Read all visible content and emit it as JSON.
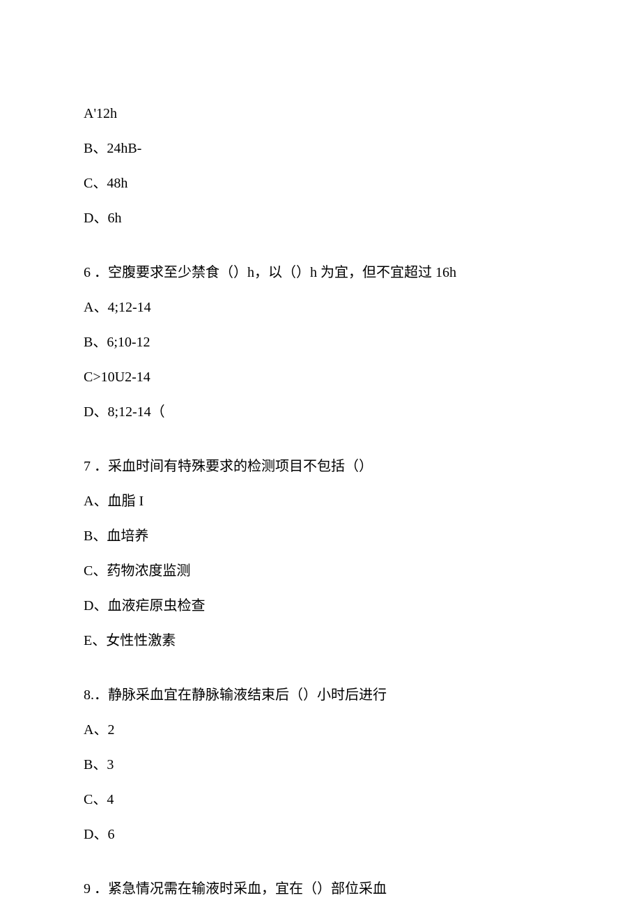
{
  "q5": {
    "optA": "A'12h",
    "optB": "B、24hB-",
    "optC": "C、48h",
    "optD": "D、6h"
  },
  "q6": {
    "stem": "6 ．空腹要求至少禁食（）h，以（）h 为宜，但不宜超过 16h",
    "optA": "A、4;12-14",
    "optB": "B、6;10-12",
    "optC": "C>10U2-14",
    "optD": "D、8;12-14（"
  },
  "q7": {
    "stem": "7 ．采血时间有特殊要求的检测项目不包括（）",
    "optA": "A、血脂 I",
    "optB": "B、血培养",
    "optC": "C、药物浓度监测",
    "optD": "D、血液疟原虫检查",
    "optE": "E、女性性激素"
  },
  "q8": {
    "stem": "8.．静脉采血宜在静脉输液结束后（）小时后进行",
    "optA": "A、2",
    "optB": "B、3",
    "optC": "C、4",
    "optD": "D、6"
  },
  "q9": {
    "stem": "9 ．紧急情况需在输液时采血，宜在（）部位采血"
  }
}
